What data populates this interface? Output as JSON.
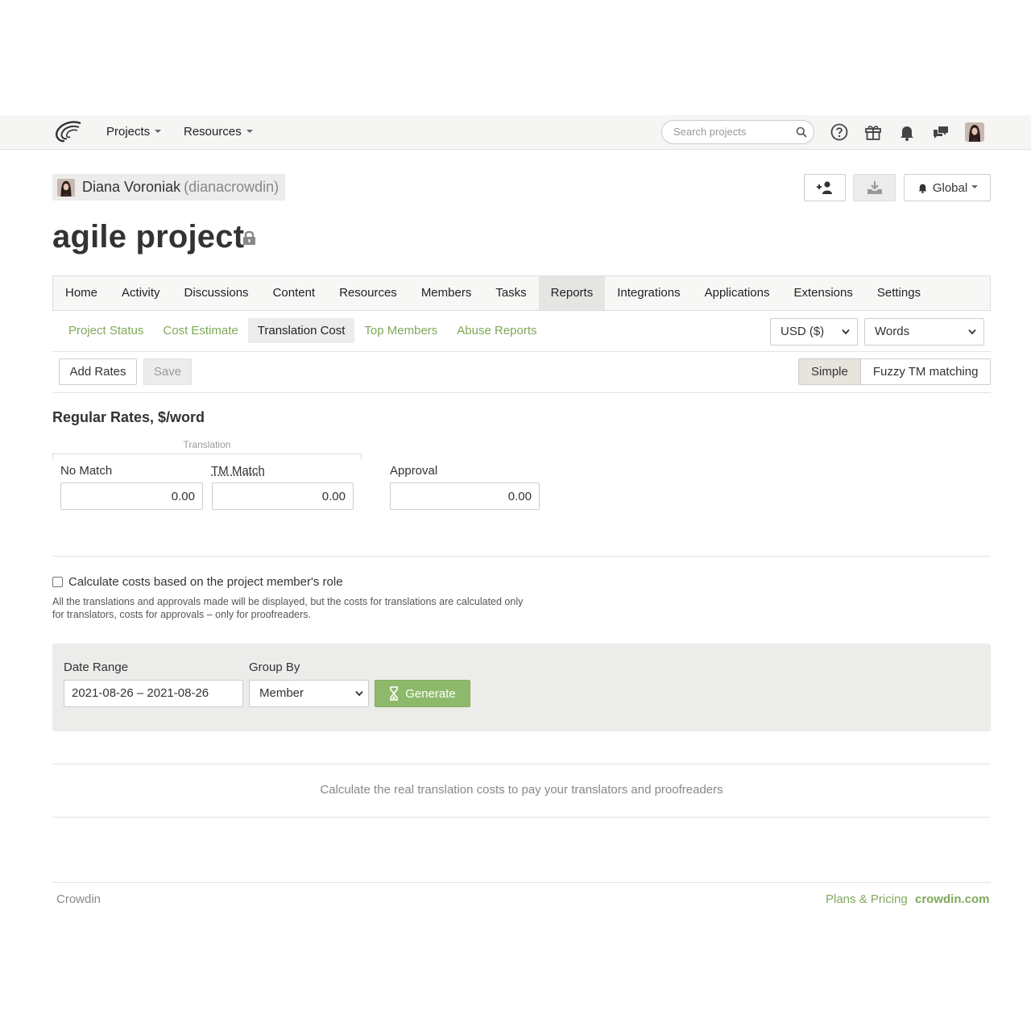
{
  "topbar": {
    "projects_label": "Projects",
    "resources_label": "Resources",
    "search_placeholder": "Search projects",
    "icons": [
      "help-icon",
      "gift-icon",
      "bell-icon",
      "messages-icon"
    ]
  },
  "owner": {
    "name": "Diana Voroniak",
    "login": "(dianacrowdin)"
  },
  "header_actions": {
    "notifications_label": "Global"
  },
  "project": {
    "title": "agile project"
  },
  "tabs": [
    "Home",
    "Activity",
    "Discussions",
    "Content",
    "Resources",
    "Members",
    "Tasks",
    "Reports",
    "Integrations",
    "Applications",
    "Extensions",
    "Settings"
  ],
  "active_tab": "Reports",
  "subtabs": [
    "Project Status",
    "Cost Estimate",
    "Translation Cost",
    "Top Members",
    "Abuse Reports"
  ],
  "active_subtab": "Translation Cost",
  "currency": {
    "selected": "USD ($)"
  },
  "unit": {
    "selected": "Words"
  },
  "toolbar": {
    "add_rates_label": "Add Rates",
    "save_label": "Save",
    "mode_simple": "Simple",
    "mode_fuzzy": "Fuzzy TM matching"
  },
  "rates": {
    "title": "Regular Rates, $/word",
    "group_label": "Translation",
    "no_match_label": "No Match",
    "no_match_value": "0.00",
    "tm_match_label": "TM Match",
    "tm_match_value": "0.00",
    "approval_label": "Approval",
    "approval_value": "0.00"
  },
  "role_option": {
    "label": "Calculate costs based on the project member's role",
    "checked": false,
    "hint": "All the translations and approvals made will be displayed, but the costs for translations are calculated only for translators, costs for approvals – only for proofreaders."
  },
  "generate_panel": {
    "date_range_label": "Date Range",
    "date_range_value": "2021-08-26 – 2021-08-26",
    "group_by_label": "Group By",
    "group_by_value": "Member",
    "generate_label": "Generate"
  },
  "empty_message": "Calculate the real translation costs to pay your translators and proofreaders",
  "footer": {
    "brand": "Crowdin",
    "plans_label": "Plans & Pricing",
    "site_label": "crowdin.com"
  },
  "colors": {
    "accent_green": "#7fa95a",
    "generate_green": "#8db96a"
  }
}
